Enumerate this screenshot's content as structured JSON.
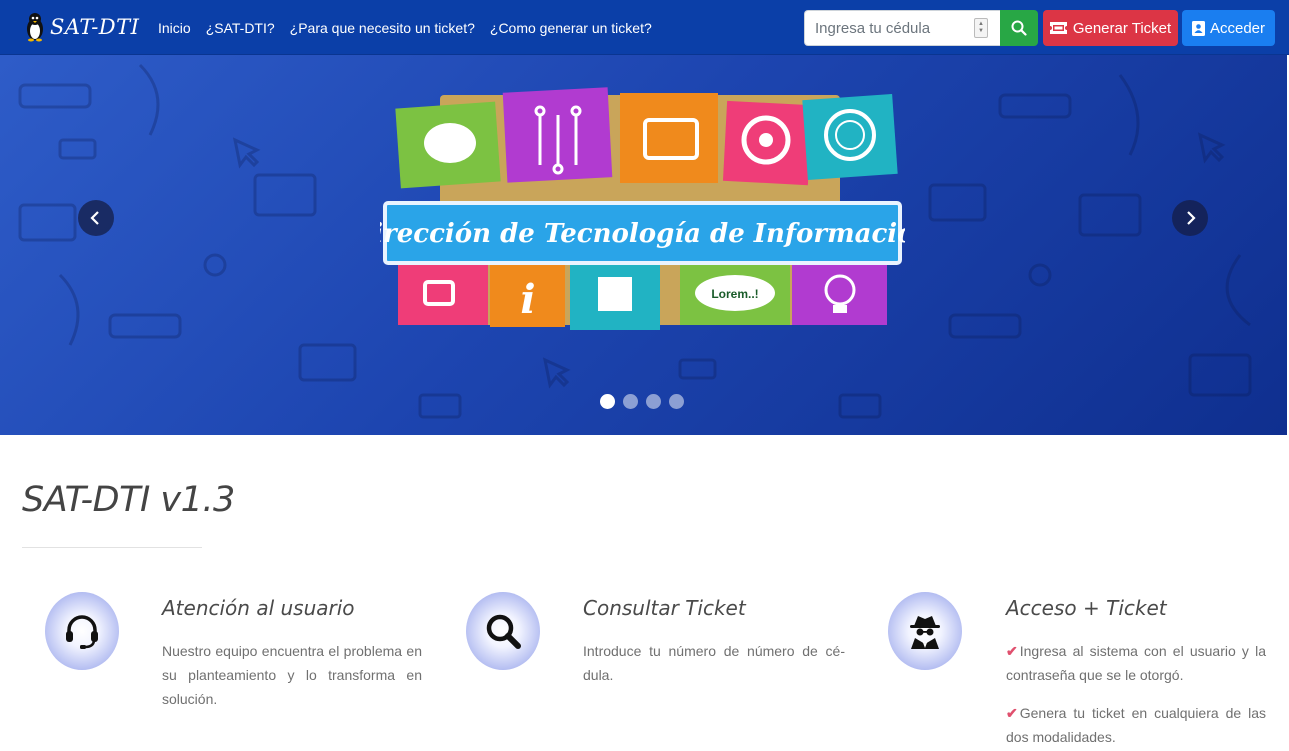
{
  "brand": {
    "name": "SAT-DTI"
  },
  "nav": {
    "links": [
      "Inicio",
      "¿SAT-DTI?",
      "¿Para que necesito un ticket?",
      "¿Como generar un ticket?"
    ]
  },
  "search": {
    "placeholder": "Ingresa tu cédula",
    "value": ""
  },
  "buttons": {
    "generate_ticket": "Generar Ticket",
    "login": "Acceder"
  },
  "carousel": {
    "banner_text": "Dirección de Tecnología de Información",
    "bubble_text": "Lorem..!",
    "slide_count": 4,
    "active_slide": 1
  },
  "main": {
    "title": "SAT-DTI v1.3",
    "features": [
      {
        "title": "Atención al usuario",
        "text": "Nuestro equipo encuentra el problema en su planteamiento y lo transforma en solución.",
        "icon": "headset-icon"
      },
      {
        "title": "Consultar Ticket",
        "text": "Introduce tu número de número de cé-dula.",
        "icon": "magnifier-icon"
      },
      {
        "title": "Acceso + Ticket",
        "items": [
          "Ingresa al sistema con el usuario y la contraseña que se le otorgó.",
          "Genera tu ticket en cualquiera de las dos modalidades."
        ],
        "icon": "spy-icon"
      }
    ]
  },
  "colors": {
    "navbar": "#0b3fa8",
    "search_button": "#28a745",
    "ticket_button": "#dc3545",
    "login_button": "#1a7ef0",
    "check": "#e0506e"
  }
}
